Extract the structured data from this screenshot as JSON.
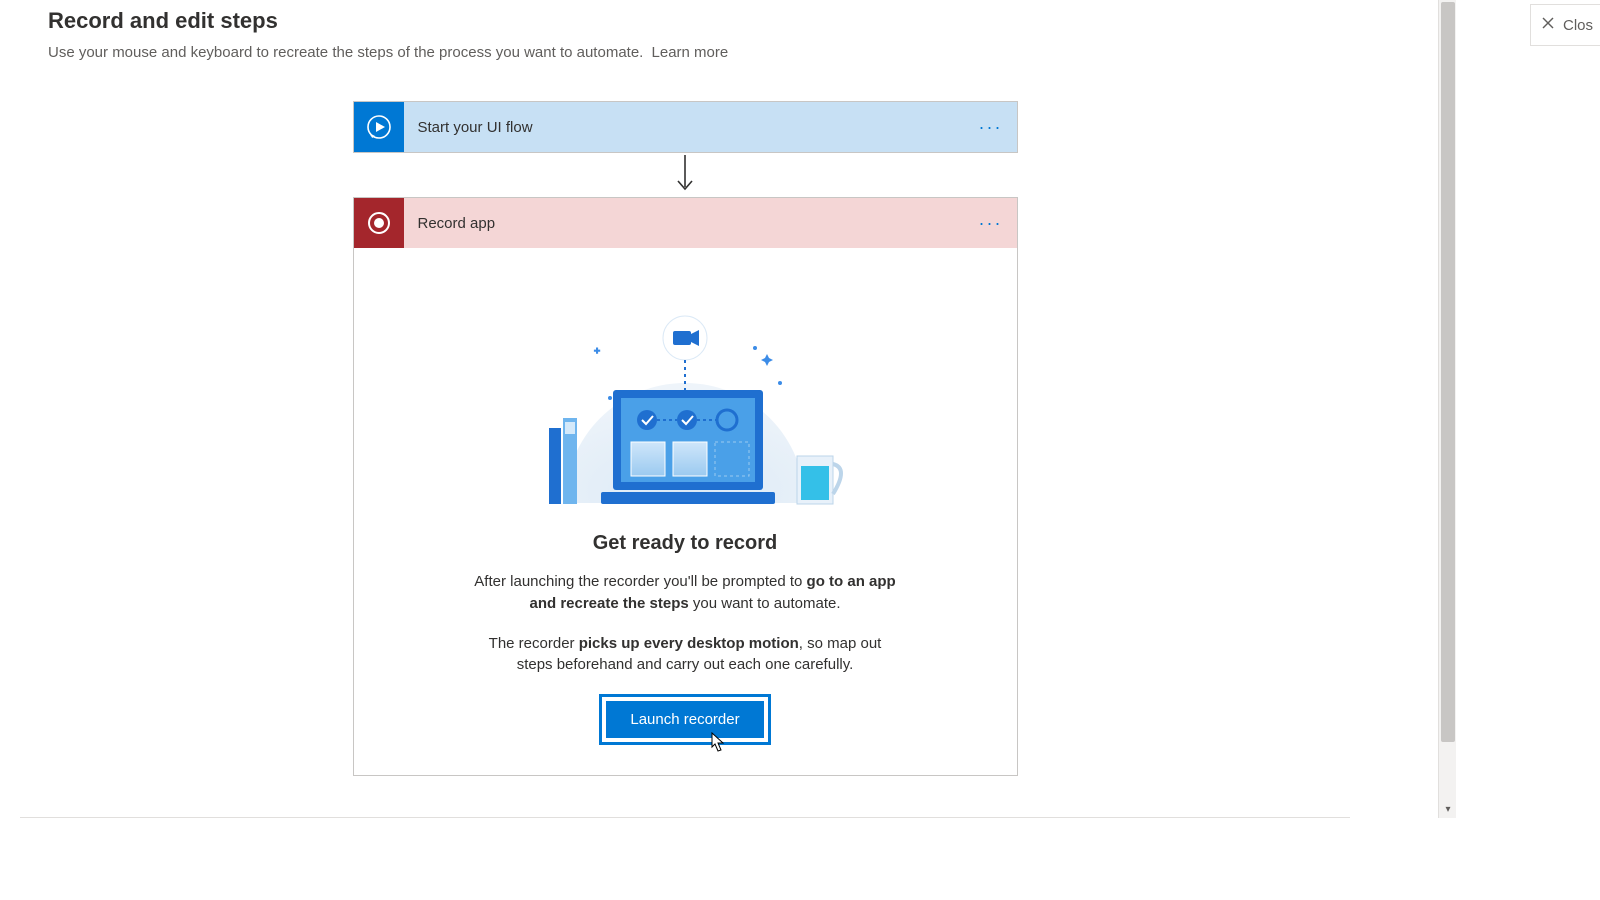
{
  "page": {
    "title": "Record and edit steps",
    "subtitle": "Use your mouse and keyboard to recreate the steps of the process you want to automate.",
    "learn_more": "Learn more"
  },
  "steps": {
    "start": {
      "label": "Start your UI flow"
    },
    "record": {
      "label": "Record app"
    }
  },
  "record_panel": {
    "heading": "Get ready to record",
    "p1_pre": "After launching the recorder you'll be prompted to ",
    "p1_bold": "go to an app and recreate the steps",
    "p1_post": " you want to automate.",
    "p2_pre": "The recorder ",
    "p2_bold": "picks up every desktop motion",
    "p2_post": ", so map out steps beforehand and carry out each one carefully.",
    "launch_label": "Launch recorder"
  },
  "close_button": {
    "label": "Clos"
  },
  "icons": {
    "more": "···"
  }
}
